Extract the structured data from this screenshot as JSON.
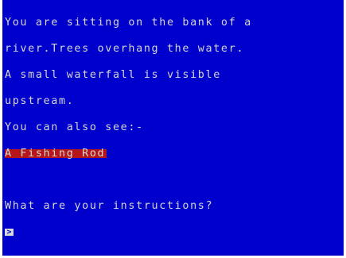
{
  "game": {
    "description_lines": [
      "You are sitting on the bank of a",
      "river.Trees overhang the water.",
      "A small waterfall is visible",
      "upstream."
    ],
    "see_label": "You can also see:-",
    "items": [
      "A Fishing Rod"
    ],
    "prompt": "What are your instructions?",
    "input_value": "",
    "cursor_symbol": ">"
  },
  "colors": {
    "background": "#0000cd",
    "text": "#d7d7d7",
    "highlight": "#b4161a",
    "border": "#ffffff"
  }
}
